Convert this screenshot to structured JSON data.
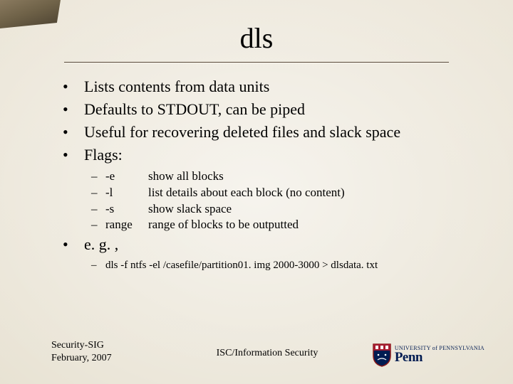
{
  "title": "dls",
  "bullets": {
    "b0": "Lists contents from data units",
    "b1": "Defaults to STDOUT, can be piped",
    "b2": "Useful for recovering deleted files and slack space",
    "b3": "Flags:",
    "b4": "e. g. ,"
  },
  "flags": {
    "f0": {
      "flag": "-e",
      "desc": "show all blocks"
    },
    "f1": {
      "flag": "-l",
      "desc": "list details about each block (no content)"
    },
    "f2": {
      "flag": "-s",
      "desc": "show slack space"
    },
    "f3": {
      "flag": "range",
      "desc": "range of blocks to be outputted"
    }
  },
  "example": "dls -f ntfs -el /casefile/partition01. img 2000-3000 > dlsdata. txt",
  "footer": {
    "left1": "Security-SIG",
    "left2": "February, 2007",
    "center": "ISC/Information Security",
    "logo_top": "UNIVERSITY of PENNSYLVANIA",
    "logo_main": "Penn"
  }
}
